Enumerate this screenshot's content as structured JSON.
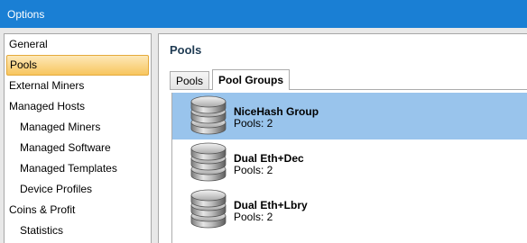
{
  "window": {
    "title": "Options"
  },
  "sidebar": {
    "items": [
      {
        "label": "General",
        "sub": false,
        "selected": false
      },
      {
        "label": "Pools",
        "sub": false,
        "selected": true
      },
      {
        "label": "External Miners",
        "sub": false,
        "selected": false
      },
      {
        "label": "Managed Hosts",
        "sub": false,
        "selected": false
      },
      {
        "label": "Managed Miners",
        "sub": true,
        "selected": false
      },
      {
        "label": "Managed Software",
        "sub": true,
        "selected": false
      },
      {
        "label": "Managed Templates",
        "sub": true,
        "selected": false
      },
      {
        "label": "Device Profiles",
        "sub": true,
        "selected": false
      },
      {
        "label": "Coins & Profit",
        "sub": false,
        "selected": false
      },
      {
        "label": "Statistics",
        "sub": true,
        "selected": false
      }
    ]
  },
  "content": {
    "title": "Pools",
    "tabs": [
      {
        "label": "Pools",
        "active": false
      },
      {
        "label": "Pool Groups",
        "active": true
      }
    ],
    "groups": [
      {
        "name": "NiceHash Group",
        "pools": "Pools: 2",
        "selected": true,
        "icon": "database-icon"
      },
      {
        "name": "Dual Eth+Dec",
        "pools": "Pools: 2",
        "selected": false,
        "icon": "database-icon"
      },
      {
        "name": "Dual Eth+Lbry",
        "pools": "Pools: 2",
        "selected": false,
        "icon": "database-icon"
      }
    ]
  },
  "colors": {
    "titlebar": "#1a7fd4",
    "selection": "#99c4ec",
    "sidebar_selection": "#f7c55e"
  }
}
